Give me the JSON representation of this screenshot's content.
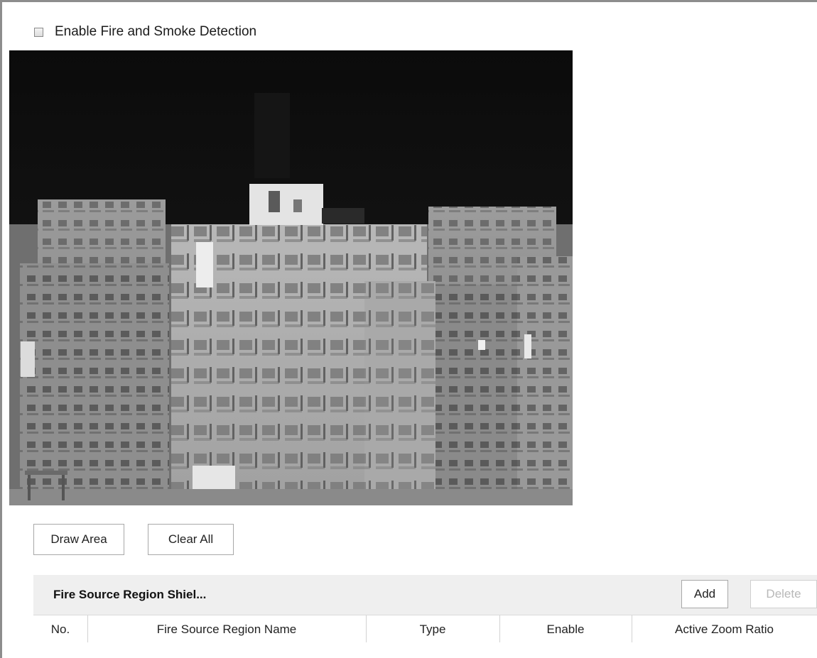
{
  "detection": {
    "enable_label": "Enable Fire and Smoke Detection",
    "checked": false
  },
  "video": {
    "description_icon": "thermal-camera-feed"
  },
  "toolbar": {
    "draw_area": "Draw Area",
    "clear_all": "Clear All"
  },
  "region_panel": {
    "title": "Fire Source Region Shiel...",
    "add_label": "Add",
    "delete_label": "Delete",
    "columns": [
      "No.",
      "Fire Source Region Name",
      "Type",
      "Enable",
      "Active Zoom Ratio"
    ]
  },
  "colors": {
    "frame": "#8d8d8d",
    "panel_header_bg": "#efefef",
    "disabled_text": "#b8b8b8"
  }
}
